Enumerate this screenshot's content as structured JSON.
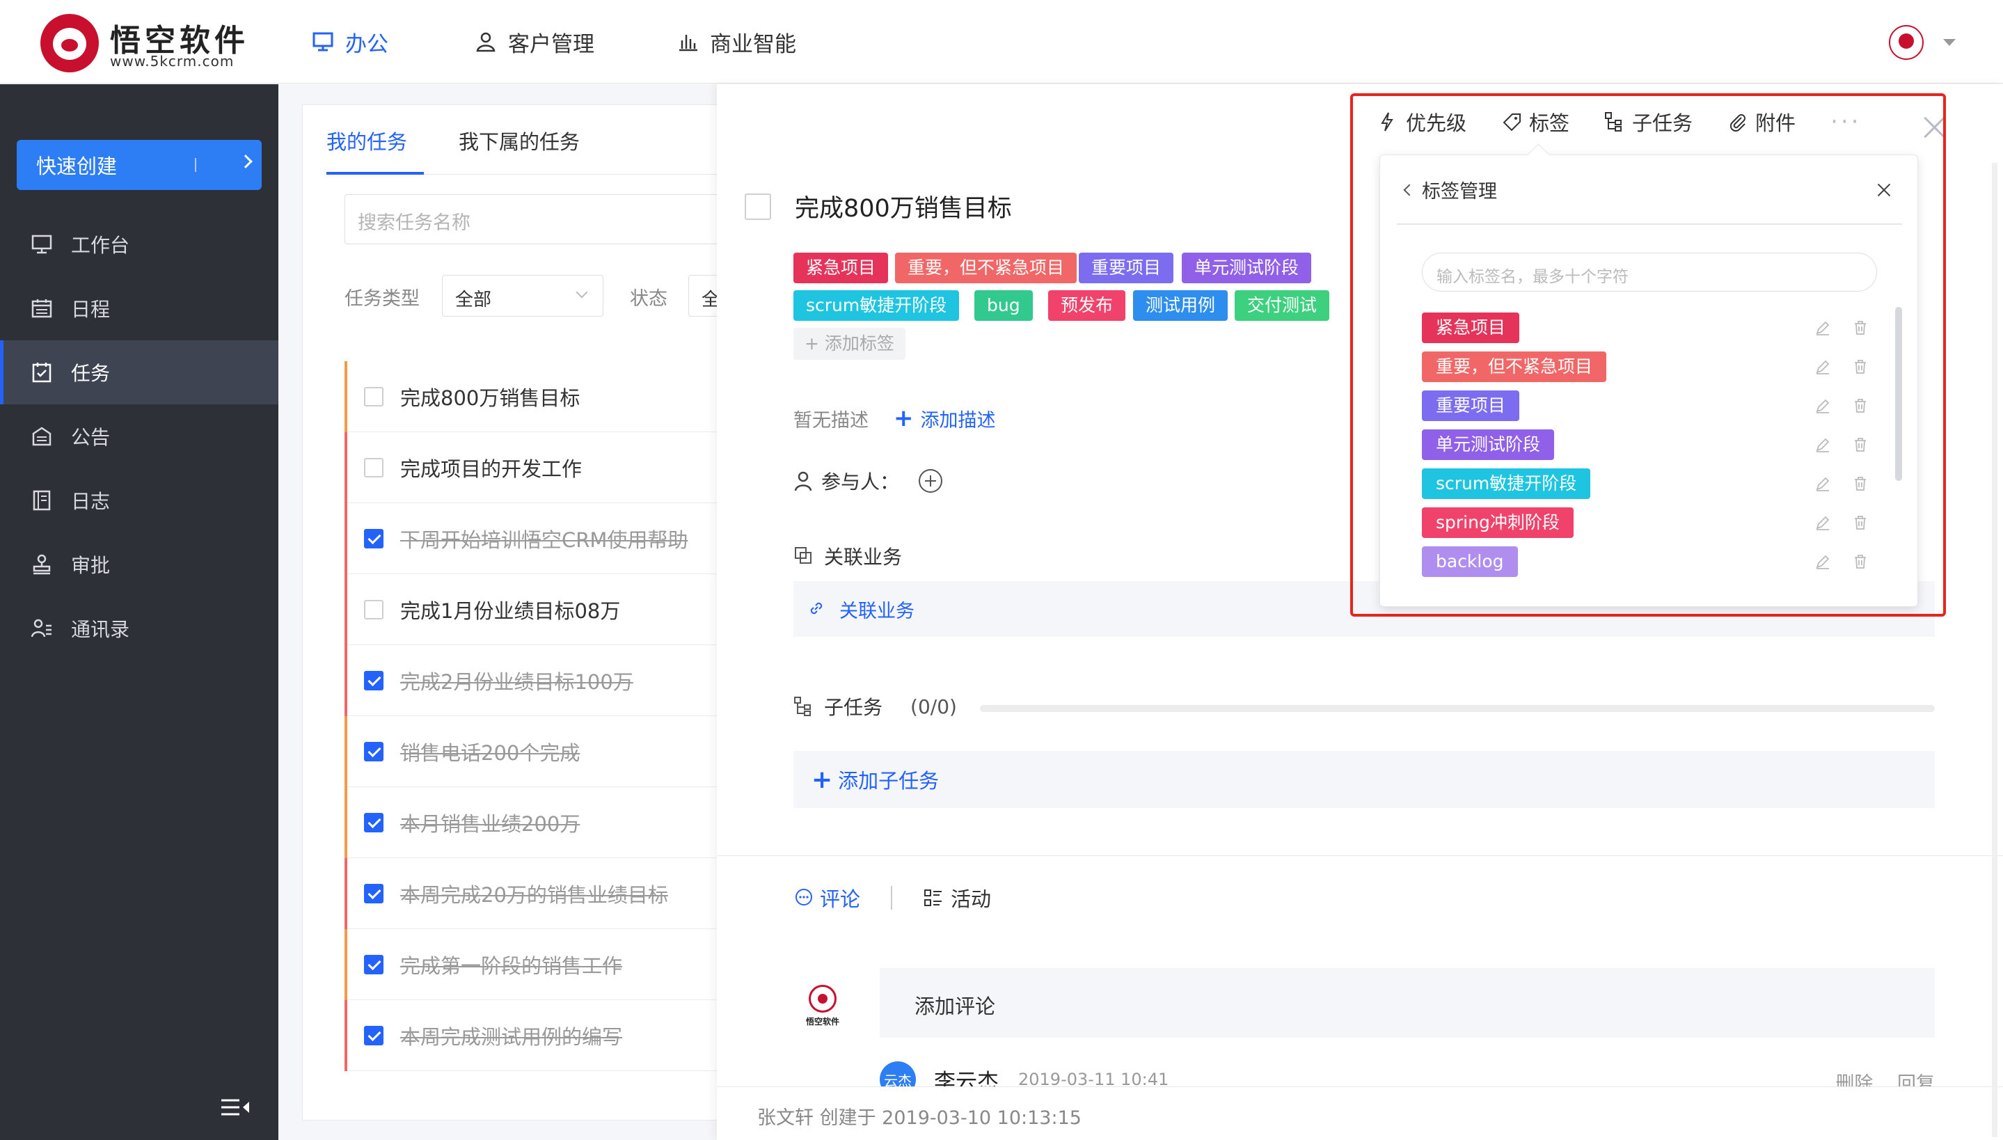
{
  "app": {
    "logo_title": "悟空软件",
    "logo_url": "www.5kcrm.com",
    "nav": [
      {
        "label": "办公",
        "icon": "monitor-icon",
        "active": true
      },
      {
        "label": "客户管理",
        "icon": "user-icon",
        "active": false
      },
      {
        "label": "商业智能",
        "icon": "bar-chart-icon",
        "active": false
      }
    ],
    "accent_color": "#2362fb"
  },
  "sidebar": {
    "quick_create": "快速创建",
    "items": [
      {
        "label": "工作台",
        "icon": "monitor-icon"
      },
      {
        "label": "日程",
        "icon": "calendar-icon"
      },
      {
        "label": "任务",
        "icon": "task-check-icon",
        "active": true
      },
      {
        "label": "公告",
        "icon": "announcement-icon"
      },
      {
        "label": "日志",
        "icon": "log-book-icon"
      },
      {
        "label": "审批",
        "icon": "stamp-icon"
      },
      {
        "label": "通讯录",
        "icon": "contacts-icon"
      }
    ]
  },
  "task_list": {
    "tabs": [
      "我的任务",
      "我下属的任务"
    ],
    "search_placeholder": "搜索任务名称",
    "filter_type_label": "任务类型",
    "filter_type_value": "全部",
    "filter_status_label": "状态",
    "filter_status_value": "全",
    "tasks": [
      {
        "title": "完成800万销售目标",
        "done": false
      },
      {
        "title": "完成项目的开发工作",
        "done": false
      },
      {
        "title": "下周开始培训悟空CRM使用帮助",
        "done": true
      },
      {
        "title": "完成1月份业绩目标08万",
        "done": false
      },
      {
        "title": "完成2月份业绩目标100万",
        "done": true
      },
      {
        "title": "销售电话200个完成",
        "done": true
      },
      {
        "title": "本月销售业绩200万",
        "done": true
      },
      {
        "title": "本周完成20万的销售业绩目标",
        "done": true
      },
      {
        "title": "完成第一阶段的销售工作",
        "done": true
      },
      {
        "title": "本周完成测试用例的编写",
        "done": true
      }
    ]
  },
  "detail": {
    "title": "完成800万销售目标",
    "tags": [
      {
        "label": "紧急项目",
        "color": "#e6335a"
      },
      {
        "label": "重要，但不紧急项目",
        "color": "#f16767"
      },
      {
        "label": "重要项目",
        "color": "#7b6cf0"
      },
      {
        "label": "单元测试阶段",
        "color": "#9160e8"
      },
      {
        "label": "scrum敏捷开阶段",
        "color": "#1fc5e0"
      },
      {
        "label": "bug",
        "color": "#32c98e"
      },
      {
        "label": "预发布",
        "color": "#f0426a"
      },
      {
        "label": "测试用例",
        "color": "#2d8ef0"
      },
      {
        "label": "交付测试",
        "color": "#3dd07e"
      }
    ],
    "add_tag_label": "+ 添加标签",
    "no_desc": "暂无描述",
    "add_desc": "添加描述",
    "members_label": "参与人：",
    "related_label": "关联业务",
    "related_link": "关联业务",
    "subtask_label": "子任务",
    "subtask_count": "(0/0)",
    "add_subtask": "添加子任务",
    "comment_tab": "评论",
    "activity_tab": "活动",
    "comment_placeholder": "添加评论",
    "comment_user": "李云杰",
    "comment_user_badge": "云杰",
    "comment_time": "2019-03-11 10:41",
    "comment_delete": "删除",
    "comment_reply": "回复",
    "footer": "张文轩 创建于 2019-03-10 10:13:15"
  },
  "toolbar": {
    "priority": "优先级",
    "tags": "标签",
    "subtask": "子任务",
    "attachment": "附件",
    "more": "···"
  },
  "tag_manager": {
    "title": "标签管理",
    "input_placeholder": "输入标签名，最多十个字符",
    "tags": [
      {
        "label": "紧急项目",
        "color": "#e6335a"
      },
      {
        "label": "重要，但不紧急项目",
        "color": "#f16767"
      },
      {
        "label": "重要项目",
        "color": "#7b6cf0"
      },
      {
        "label": "单元测试阶段",
        "color": "#9160e8"
      },
      {
        "label": "scrum敏捷开阶段",
        "color": "#1fc5e0"
      },
      {
        "label": "spring冲刺阶段",
        "color": "#f0426a"
      },
      {
        "label": "backlog",
        "color": "#b08ef0"
      }
    ]
  }
}
